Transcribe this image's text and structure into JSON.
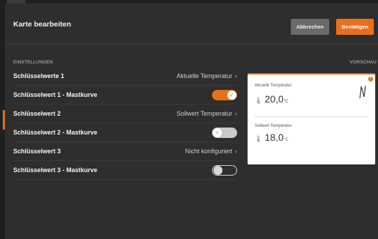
{
  "header": {
    "title": "Karte bearbeiten",
    "cancel_label": "Abbrechen",
    "confirm_label": "Bestätigen"
  },
  "sections": {
    "settings": "EINSTELLUNGEN",
    "preview": "VORSCHAU"
  },
  "rows": [
    {
      "label": "Schlüsselwerte 1",
      "value": "Aktuelle Temperatur"
    },
    {
      "label": "Schlüsselwert 1 - Mastkurve",
      "toggle": "on"
    },
    {
      "label": "Schlüsselwert 2",
      "value": "Sollwert Temperatur"
    },
    {
      "label": "Schlüsselwert 2 - Mastkurve",
      "toggle": "off"
    },
    {
      "label": "Schlüsselwert 3",
      "value": "Nicht konfiguriert"
    },
    {
      "label": "Schlüsselwert 3 - Mastkurve",
      "toggle": "off"
    }
  ],
  "preview": {
    "warning_glyph": "!",
    "item1": {
      "label": "Aktuelle Temperatur",
      "value": "20,0",
      "unit": "°C"
    },
    "item2": {
      "label": "Sollwert Temperatur",
      "value": "18,0",
      "unit": "°C"
    }
  },
  "icons": {
    "chevron": "chevron-right-icon",
    "thermometer": "thermometer-icon",
    "check": "check-icon",
    "cross": "close-icon"
  },
  "colors": {
    "accent": "#e8701a",
    "background": "#2e2e2e",
    "card": "#ffffff"
  }
}
